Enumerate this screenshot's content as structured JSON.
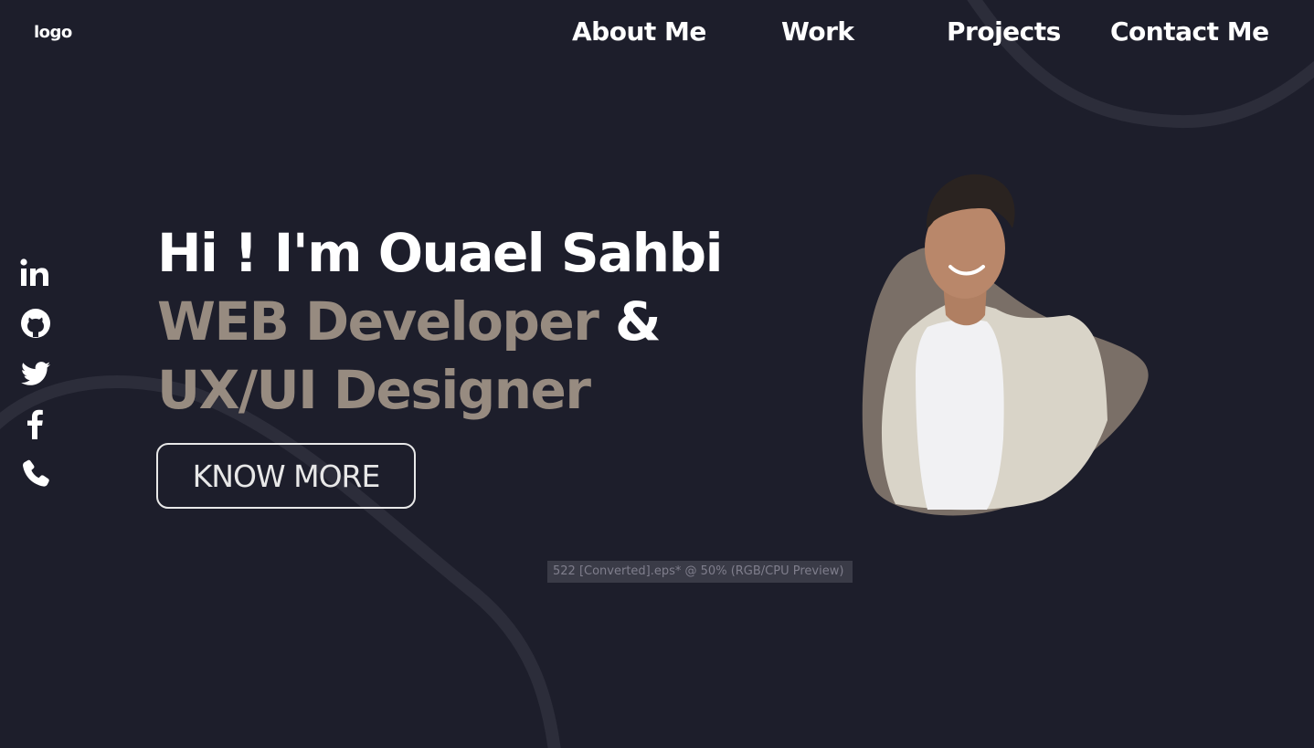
{
  "header": {
    "logo": "logo",
    "nav": [
      {
        "label": "About Me"
      },
      {
        "label": "Work"
      },
      {
        "label": "Projects"
      },
      {
        "label": "Contact Me"
      }
    ]
  },
  "social": [
    {
      "icon": "linkedin-icon"
    },
    {
      "icon": "github-icon"
    },
    {
      "icon": "twitter-icon"
    },
    {
      "icon": "facebook-icon"
    },
    {
      "icon": "phone-icon"
    }
  ],
  "hero": {
    "greeting": "Hi ! I'm Ouael Sahbi",
    "role1": "WEB Developer",
    "amp": "&",
    "role2": "UX/UI Designer",
    "cta_label": "KNOW MORE"
  },
  "preview_label": "522 [Converted].eps* @ 50% (RGB/CPU Preview)",
  "colors": {
    "background": "#1d1e2b",
    "accent": "#978b80",
    "text": "#ffffff",
    "blob": "#7a6f67",
    "decor_line": "#2c2d3a"
  }
}
